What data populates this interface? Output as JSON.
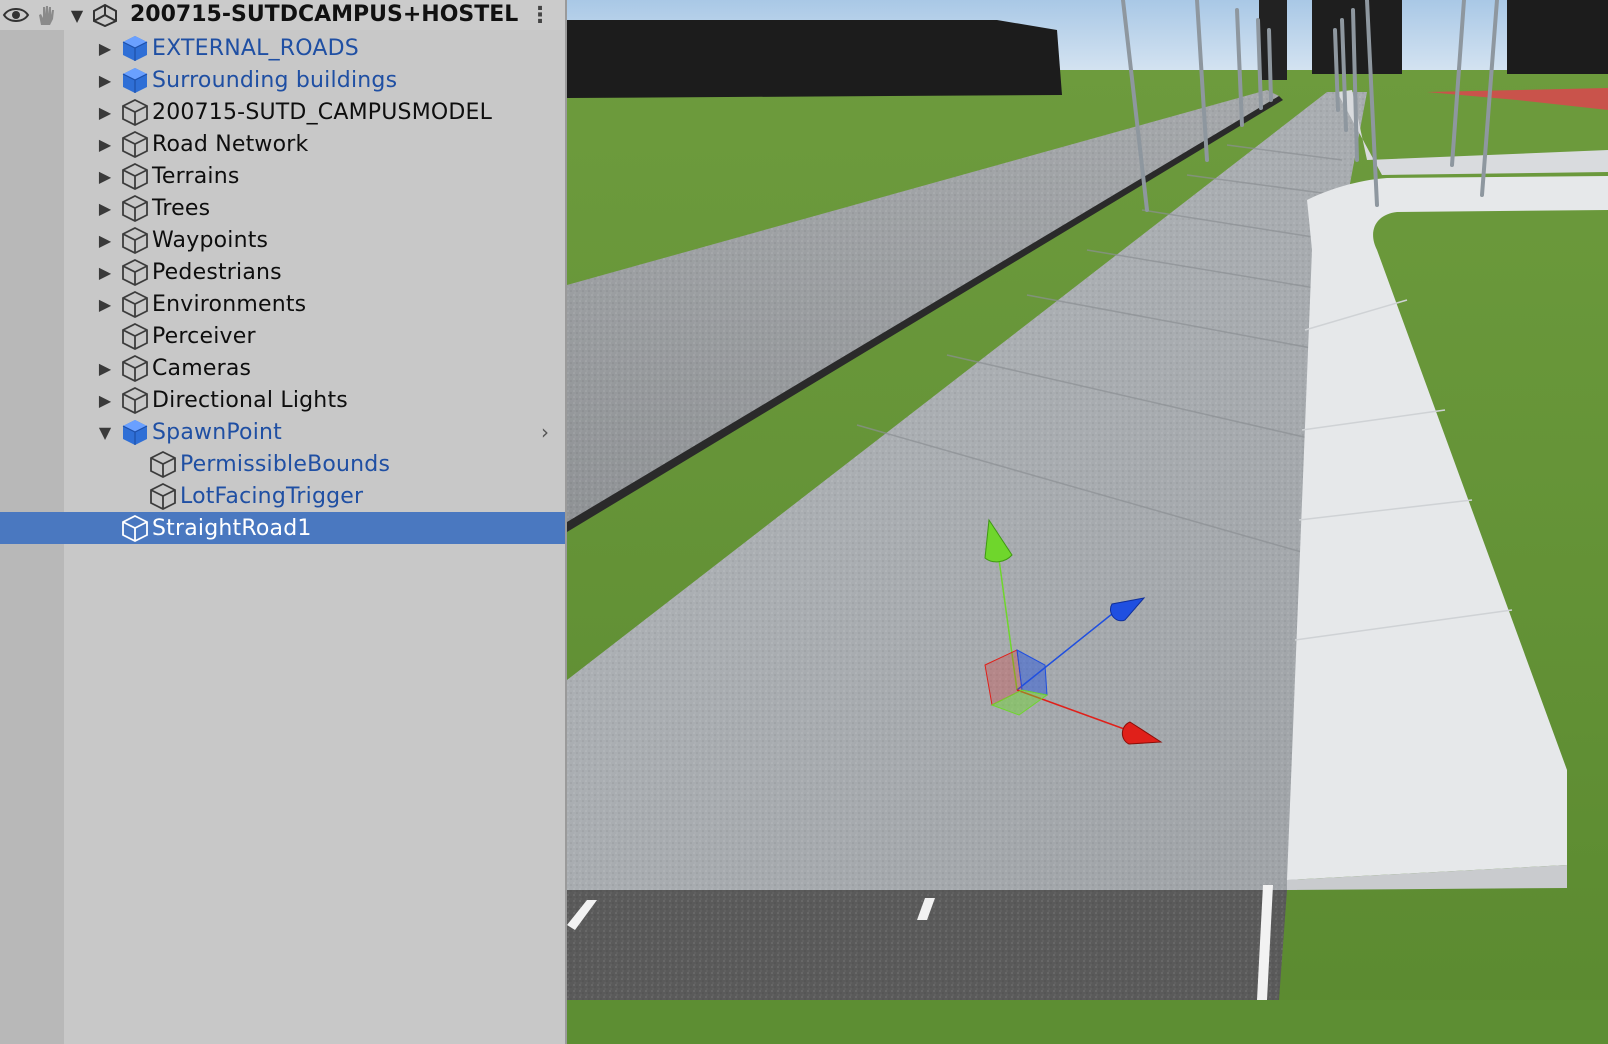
{
  "scene": {
    "title": "200715-SUTDCAMPUS+HOSTEL",
    "menu_glyph": "⋮"
  },
  "hierarchy": {
    "items": [
      {
        "label": "EXTERNAL_ROADS",
        "expanded": false,
        "prefab": true,
        "depth": 0
      },
      {
        "label": "Surrounding buildings",
        "expanded": false,
        "prefab": true,
        "depth": 0
      },
      {
        "label": "200715-SUTD_CAMPUSMODEL",
        "expanded": false,
        "prefab": false,
        "depth": 0
      },
      {
        "label": "Road Network",
        "expanded": false,
        "prefab": false,
        "depth": 0
      },
      {
        "label": "Terrains",
        "expanded": false,
        "prefab": false,
        "depth": 0
      },
      {
        "label": "Trees",
        "expanded": false,
        "prefab": false,
        "depth": 0
      },
      {
        "label": "Waypoints",
        "expanded": false,
        "prefab": false,
        "depth": 0
      },
      {
        "label": "Pedestrians",
        "expanded": false,
        "prefab": false,
        "depth": 0
      },
      {
        "label": "Environments",
        "expanded": false,
        "prefab": false,
        "depth": 0
      },
      {
        "label": "Perceiver",
        "expanded": null,
        "prefab": false,
        "depth": 0
      },
      {
        "label": "Cameras",
        "expanded": false,
        "prefab": false,
        "depth": 0
      },
      {
        "label": "Directional Lights",
        "expanded": false,
        "prefab": false,
        "depth": 0
      },
      {
        "label": "SpawnPoint",
        "expanded": true,
        "prefab": true,
        "depth": 0
      },
      {
        "label": "PermissibleBounds",
        "expanded": null,
        "prefab": true,
        "depth": 1
      },
      {
        "label": "LotFacingTrigger",
        "expanded": null,
        "prefab": true,
        "depth": 1
      },
      {
        "label": "StraightRoad1",
        "expanded": null,
        "prefab": false,
        "depth": 0,
        "selected": true
      }
    ],
    "fold_closed": "▶",
    "fold_open": "▼",
    "row_chevron": "›"
  },
  "colors": {
    "selection": "#4a78c0",
    "prefab_text": "#1f4fa3",
    "axis_x": "#e0201a",
    "axis_y": "#6fd62c",
    "axis_z": "#1f4fe0"
  },
  "icons": [
    "eye-icon",
    "hand-icon",
    "unity-logo-icon",
    "gameobject-cube-icon",
    "prefab-cube-icon"
  ]
}
